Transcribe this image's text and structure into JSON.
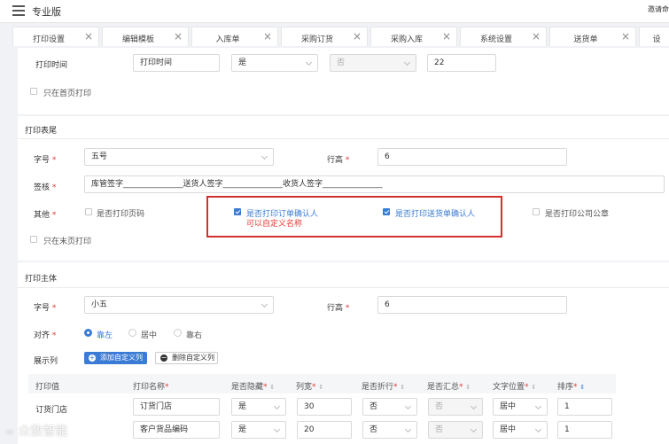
{
  "header": {
    "title": "专业版",
    "right_text": "邀请命"
  },
  "tabs": [
    {
      "label": "打印设置"
    },
    {
      "label": "编辑模板"
    },
    {
      "label": "入库单"
    },
    {
      "label": "采购订货"
    },
    {
      "label": "采购入库"
    },
    {
      "label": "系统设置"
    },
    {
      "label": "送货单"
    },
    {
      "label": "设"
    }
  ],
  "print_time_row": {
    "label": "打印时间",
    "name_value": "打印时间",
    "show_value": "是",
    "fold_value": "否",
    "width_value": "22"
  },
  "first_page_only": {
    "label": "只在首页打印",
    "checked": false
  },
  "footer_section": {
    "title": "打印表尾",
    "font_label": "字号",
    "font_value": "五号",
    "row_height_label": "行高",
    "row_height_value": "6",
    "signature_label": "签核",
    "signature_value": "库管签字_______________送货人签字_______________收货人签字_______________",
    "other_label": "其他",
    "options": [
      {
        "label": "是否打印页码",
        "checked": false
      },
      {
        "label": "是否打印订单确认人",
        "checked": true
      },
      {
        "label": "是否打印送货单确认人",
        "checked": true
      },
      {
        "label": "是否打印公司公章",
        "checked": false
      }
    ],
    "note": "可以自定义名称",
    "last_page_only": {
      "label": "只在末页打印",
      "checked": false
    }
  },
  "body_section": {
    "title": "打印主体",
    "font_label": "字号",
    "font_value": "小五",
    "row_height_label": "行高",
    "row_height_value": "6",
    "align_label": "对齐",
    "align_options": [
      {
        "label": "靠左",
        "selected": true
      },
      {
        "label": "居中",
        "selected": false
      },
      {
        "label": "靠右",
        "selected": false
      }
    ],
    "columns_label": "展示列",
    "add_custom_label": "添加自定义列",
    "delete_custom_label": "删除自定义列"
  },
  "table": {
    "headers": [
      "打印值",
      "打印名称",
      "是否隐藏",
      "列宽",
      "是否折行",
      "是否汇总",
      "文字位置",
      "排序"
    ],
    "required": [
      false,
      true,
      true,
      true,
      true,
      true,
      true,
      true
    ],
    "rows": [
      {
        "field": "订货门店",
        "name": "订货门店",
        "hidden": "是",
        "width": "30",
        "wrap": "否",
        "sum": "否",
        "position": "居中",
        "order": "1"
      },
      {
        "field": "",
        "name": "客户货品编码",
        "hidden": "是",
        "width": "20",
        "wrap": "否",
        "sum": "否",
        "position": "居中",
        "order": "1"
      }
    ]
  },
  "watermark": "众数智能"
}
